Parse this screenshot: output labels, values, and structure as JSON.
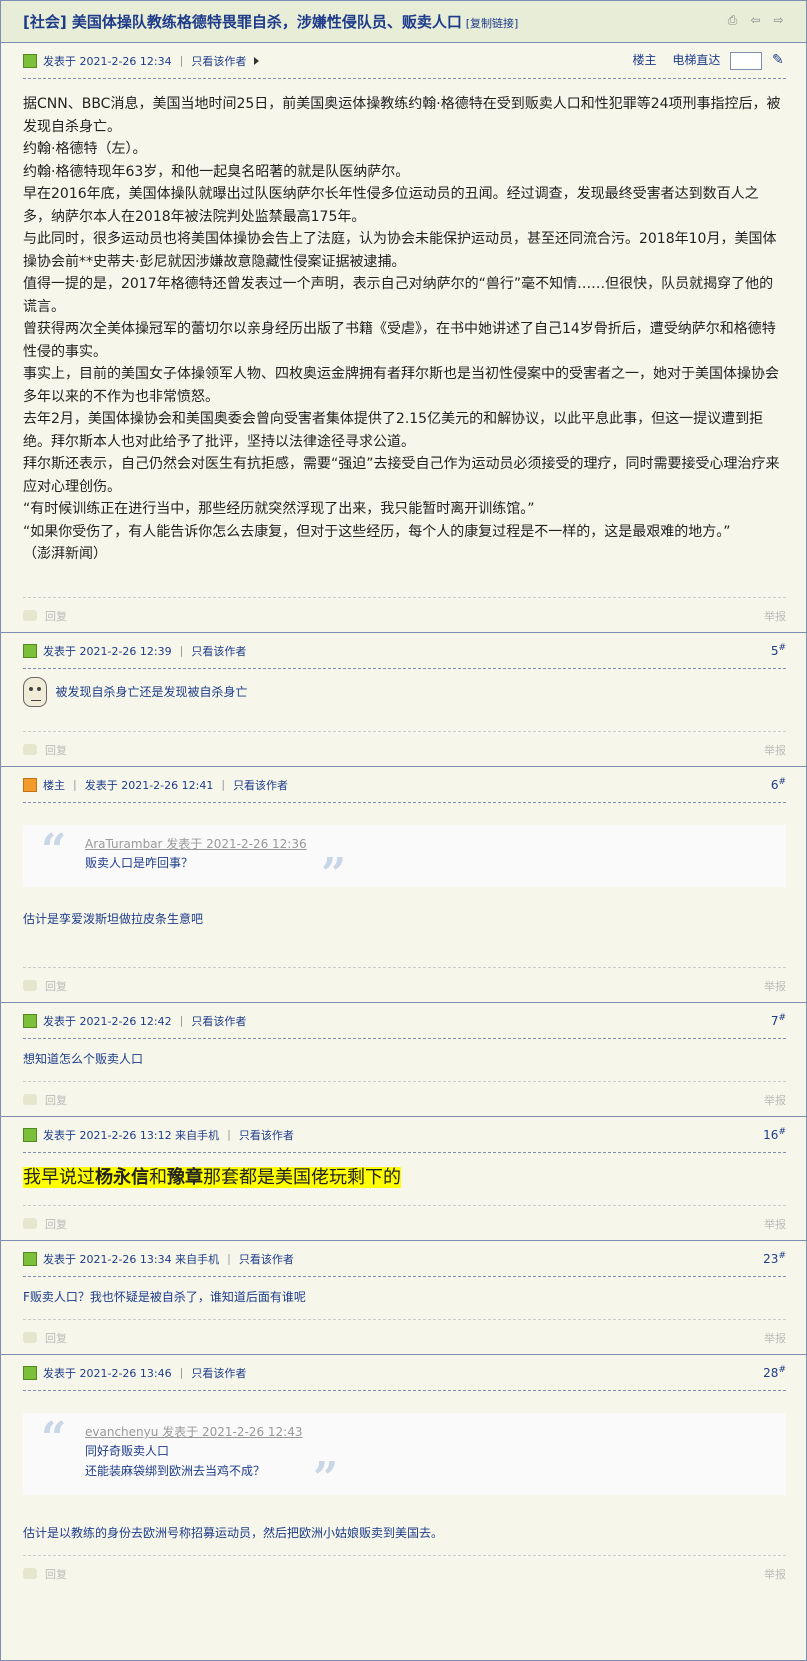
{
  "thread": {
    "title": "[社会] 美国体操队教练格德特畏罪自杀，涉嫌性侵队员、贩卖人口",
    "copy_link": "[复制链接]"
  },
  "op": {
    "posted": "发表于 2021-2-26 12:34",
    "only_author": "只看该作者",
    "floor_label": "楼主",
    "jump_label": "电梯直达",
    "paragraphs": [
      "据CNN、BBC消息，美国当地时间25日，前美国奥运体操教练约翰·格德特在受到贩卖人口和性犯罪等24项刑事指控后，被发现自杀身亡。",
      "约翰·格德特（左）。",
      "约翰·格德特现年63岁，和他一起臭名昭著的就是队医纳萨尔。",
      "早在2016年底，美国体操队就曝出过队医纳萨尔长年性侵多位运动员的丑闻。经过调查，发现最终受害者达到数百人之多，纳萨尔本人在2018年被法院判处监禁最高175年。",
      "与此同时，很多运动员也将美国体操协会告上了法庭，认为协会未能保护运动员，甚至还同流合污。2018年10月，美国体操协会前**史蒂夫·彭尼就因涉嫌故意隐藏性侵案证据被逮捕。",
      "值得一提的是，2017年格德特还曾发表过一个声明，表示自己对纳萨尔的“兽行”毫不知情……但很快，队员就揭穿了他的谎言。",
      "曾获得两次全美体操冠军的蕾切尔以亲身经历出版了书籍《受虐》，在书中她讲述了自己14岁骨折后，遭受纳萨尔和格德特性侵的事实。",
      "事实上，目前的美国女子体操领军人物、四枚奥运金牌拥有者拜尔斯也是当初性侵案中的受害者之一，她对于美国体操协会多年以来的不作为也非常愤怒。",
      "去年2月，美国体操协会和美国奥委会曾向受害者集体提供了2.15亿美元的和解协议，以此平息此事，但这一提议遭到拒绝。拜尔斯本人也对此给予了批评，坚持以法律途径寻求公道。",
      "拜尔斯还表示，自己仍然会对医生有抗拒感，需要“强迫”去接受自己作为运动员必须接受的理疗，同时需要接受心理治疗来应对心理创伤。",
      "“有时候训练正在进行当中，那些经历就突然浮现了出来，我只能暂时离开训练馆。”",
      "“如果你受伤了，有人能告诉你怎么去康复，但对于这些经历，每个人的康复过程是不一样的，这是最艰难的地方。”",
      "（澎湃新闻）"
    ]
  },
  "common": {
    "reply": "回复",
    "report": "举报",
    "only_author": "只看该作者",
    "op_badge": "楼主"
  },
  "posts": [
    {
      "posted": "发表于 2021-2-26 12:39",
      "floor": "5",
      "text": "被发现自杀身亡还是发现被自杀身亡"
    },
    {
      "posted": "发表于 2021-2-26 12:41",
      "floor": "6",
      "quote_head": "AraTurambar 发表于 2021-2-26 12:36",
      "quote_lines": [
        "贩卖人口是咋回事？"
      ],
      "text": "估计是孪爱泼斯坦做拉皮条生意吧"
    },
    {
      "posted": "发表于 2021-2-26 12:42",
      "floor": "7",
      "text": "想知道怎么个贩卖人口"
    },
    {
      "posted": "发表于 2021-2-26 13:12 来自手机",
      "floor": "16",
      "hl_pre": "我早说过",
      "hl_b1": "杨永信",
      "hl_mid": "和",
      "hl_b2": "豫章",
      "hl_post": "那套都是美国佬玩剩下的"
    },
    {
      "posted": "发表于 2021-2-26 13:34 来自手机",
      "floor": "23",
      "text": "F贩卖人口？我也怀疑是被自杀了，谁知道后面有谁呢"
    },
    {
      "posted": "发表于 2021-2-26 13:46",
      "floor": "28",
      "quote_head": "evanchenyu 发表于 2021-2-26 12:43",
      "quote_lines": [
        "同好奇贩卖人口",
        "还能装麻袋绑到欧洲去当鸡不成？"
      ],
      "text": "估计是以教练的身份去欧洲号称招募运动员，然后把欧洲小姑娘贩卖到美国去。"
    }
  ]
}
